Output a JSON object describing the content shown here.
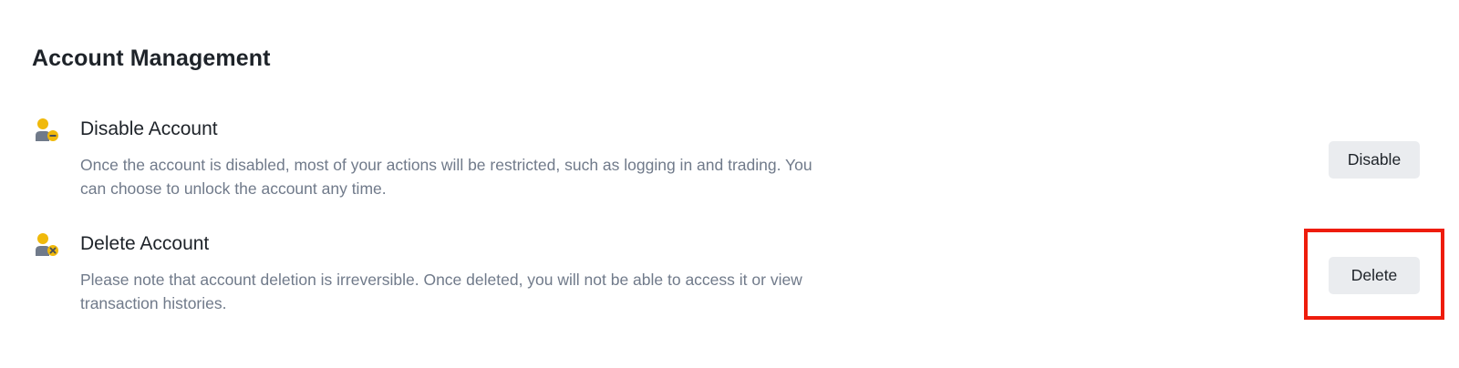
{
  "section": {
    "title": "Account Management"
  },
  "items": [
    {
      "icon": "user-minus-icon",
      "title": "Disable Account",
      "description": "Once the account is disabled, most of your actions will be restricted, such as logging in and trading. You can choose to unlock the account any time.",
      "button_label": "Disable"
    },
    {
      "icon": "user-delete-icon",
      "title": "Delete Account",
      "description": "Please note that account deletion is irreversible. Once deleted, you will not be able to access it or view transaction histories.",
      "button_label": "Delete"
    }
  ],
  "colors": {
    "accent_yellow": "#f0b90b",
    "icon_gray": "#707a8a",
    "text_primary": "#1e2329",
    "text_secondary": "#707a8a",
    "button_bg": "#eaecef",
    "highlight_red": "#ee1c0c"
  }
}
